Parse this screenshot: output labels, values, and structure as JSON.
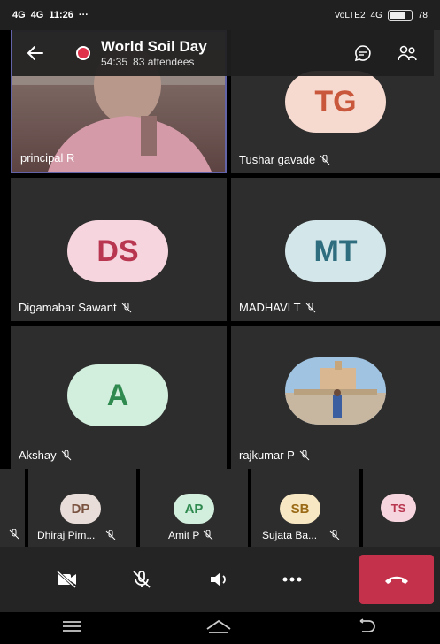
{
  "status": {
    "network1": "4G",
    "network2": "4G",
    "time": "11:26",
    "lte_label": "VoLTE2",
    "lte2": "4G",
    "battery": "78"
  },
  "header": {
    "title": "World Soil Day",
    "duration": "54:35",
    "attendees": "83 attendees"
  },
  "tiles": [
    {
      "name": "principal R",
      "kind": "video"
    },
    {
      "name": "Tushar gavade",
      "initials": "TG",
      "avatar_color": "#f6d9cf",
      "text_color": "#c9573b"
    },
    {
      "name": "Digamabar Sawant",
      "initials": "DS",
      "avatar_color": "#f7d5de",
      "text_color": "#b8364f"
    },
    {
      "name": "MADHAVI T",
      "initials": "MT",
      "avatar_color": "#d3e6ea",
      "text_color": "#2f6e7f"
    },
    {
      "name": "Akshay",
      "initials": "A",
      "avatar_color": "#d2eedd",
      "text_color": "#2f8a4f"
    },
    {
      "name": "rajkumar P",
      "kind": "photo"
    }
  ],
  "strip": [
    {
      "name": "Dhiraj Pim...",
      "initials": "DP",
      "avatar_color": "#e8ddd8",
      "text_color": "#7a5240"
    },
    {
      "name": "Amit P",
      "initials": "AP",
      "avatar_color": "#d2eedd",
      "text_color": "#2f8a4f"
    },
    {
      "name": "Sujata Ba...",
      "initials": "SB",
      "avatar_color": "#f7e7c2",
      "text_color": "#9a6a16"
    },
    {
      "name": "",
      "initials": "TS",
      "avatar_color": "#f7d5de",
      "text_color": "#b8364f"
    }
  ],
  "colors": {
    "hangup": "#c4314b",
    "tile_bg": "#2d2d2d",
    "accent_border": "#6264a7"
  }
}
